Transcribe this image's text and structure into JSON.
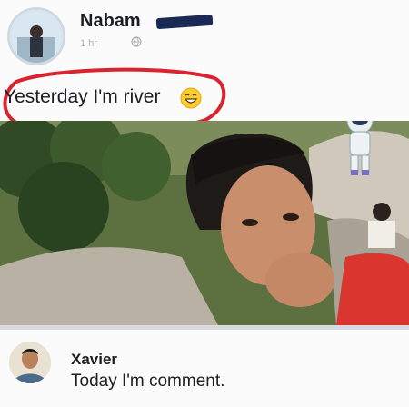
{
  "post": {
    "author_name": "Nabam",
    "time": "1 hr",
    "caption": "Yesterday I'm river"
  },
  "comment": {
    "author": "Xavier",
    "text": "Today I'm comment."
  },
  "icons": {
    "privacy": "globe-icon",
    "emoji": "grinning-face-emoji",
    "sticker": "astronaut-sticker"
  },
  "colors": {
    "highlight_circle": "#d9232f",
    "redaction": "#1a2a55",
    "text": "#1c1e21"
  }
}
